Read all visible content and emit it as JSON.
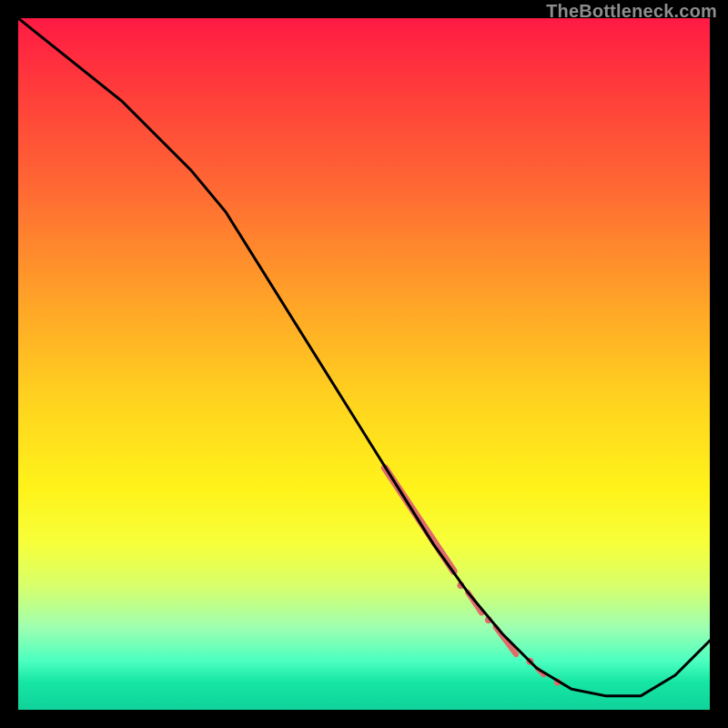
{
  "watermark": "TheBottleneck.com",
  "chart_data": {
    "type": "line",
    "title": "",
    "xlabel": "",
    "ylabel": "",
    "xlim": [
      0,
      100
    ],
    "ylim": [
      0,
      100
    ],
    "grid": false,
    "legend": false,
    "series": [
      {
        "name": "curve",
        "color": "#000000",
        "x": [
          0,
          5,
          10,
          15,
          20,
          25,
          30,
          35,
          40,
          45,
          50,
          55,
          60,
          65,
          70,
          75,
          80,
          85,
          90,
          95,
          100
        ],
        "y": [
          100,
          96,
          92,
          88,
          83,
          78,
          72,
          64,
          56,
          48,
          40,
          32,
          24,
          17,
          11,
          6,
          3,
          2,
          2,
          5,
          10
        ]
      }
    ],
    "highlights": {
      "name": "segment-markers",
      "color": "#e06b6b",
      "segments": [
        {
          "x0": 53,
          "y0": 35,
          "x1": 63,
          "y1": 20,
          "width": 8
        },
        {
          "x0": 65,
          "y0": 17,
          "x1": 67,
          "y1": 14,
          "width": 6
        },
        {
          "x0": 69,
          "y0": 12,
          "x1": 72,
          "y1": 8,
          "width": 6
        },
        {
          "x0": 75,
          "y0": 6,
          "x1": 76,
          "y1": 5,
          "width": 5
        }
      ],
      "dots": [
        {
          "x": 64,
          "y": 18,
          "r": 4
        },
        {
          "x": 68,
          "y": 13,
          "r": 4
        },
        {
          "x": 74,
          "y": 7,
          "r": 4
        },
        {
          "x": 78,
          "y": 4,
          "r": 4
        }
      ]
    }
  }
}
